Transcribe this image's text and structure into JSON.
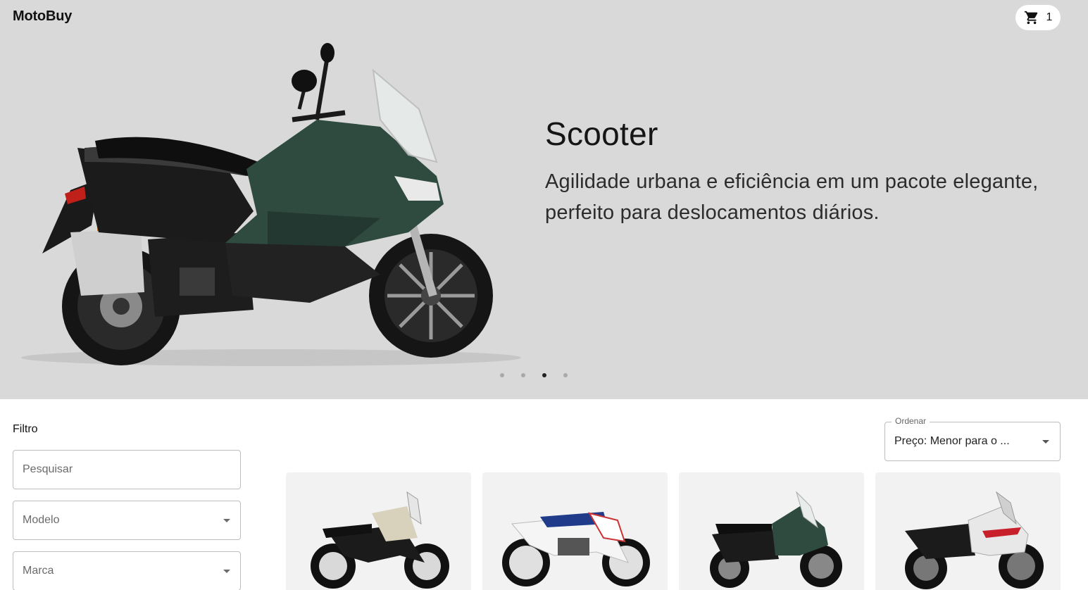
{
  "header": {
    "brand": "MotoBuy",
    "cart_count": "1",
    "cart_icon": "shopping-cart-icon"
  },
  "hero": {
    "title": "Scooter",
    "subtitle": "Agilidade urbana e eficiência em um pacote elegante, perfeito para deslocamentos diários.",
    "slides_total": 4,
    "active_slide": 3,
    "bike_color": "#2f4a3f"
  },
  "filter": {
    "label": "Filtro",
    "search_placeholder": "Pesquisar",
    "model_placeholder": "Modelo",
    "brand_placeholder": "Marca"
  },
  "sort": {
    "label": "Ordenar",
    "value": "Preço: Menor para o ..."
  },
  "products": [
    {
      "accent": "#d8d2bd"
    },
    {
      "accent": "#1f3b8a"
    },
    {
      "accent": "#2f4a3f"
    },
    {
      "accent": "#e8e8e8"
    }
  ],
  "colors": {
    "hero_bg": "#d9d9d9",
    "card_bg": "#f2f2f2"
  }
}
